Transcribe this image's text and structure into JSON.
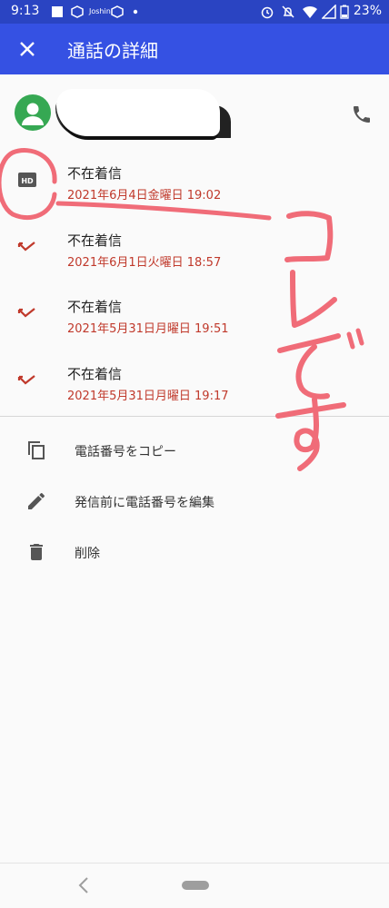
{
  "status_bar": {
    "time": "9:13",
    "notif_text_1": "Joshin",
    "battery": "23%"
  },
  "app_bar": {
    "title": "通話の詳細",
    "close_icon": "close-icon"
  },
  "contact": {
    "avatar_icon": "person-icon",
    "call_icon": "phone-icon"
  },
  "calls": [
    {
      "title": "不在着信",
      "date": "2021年6月4日金曜日 19:02",
      "icon": "hd-icon"
    },
    {
      "title": "不在着信",
      "date": "2021年6月1日火曜日 18:57",
      "icon": "missed-call-icon"
    },
    {
      "title": "不在着信",
      "date": "2021年5月31日月曜日 19:51",
      "icon": "missed-call-icon"
    },
    {
      "title": "不在着信",
      "date": "2021年5月31日月曜日 19:17",
      "icon": "missed-call-icon"
    }
  ],
  "actions": [
    {
      "label": "電話番号をコピー",
      "icon": "copy-icon"
    },
    {
      "label": "発信前に電話番号を編集",
      "icon": "edit-icon"
    },
    {
      "label": "削除",
      "icon": "delete-icon"
    }
  ],
  "annotation": {
    "text": "コレです",
    "color": "#f06c78"
  },
  "colors": {
    "status_bar": "#2a44c2",
    "app_bar": "#3551e3",
    "missed_red": "#c0392b",
    "avatar_green": "#36a853"
  }
}
